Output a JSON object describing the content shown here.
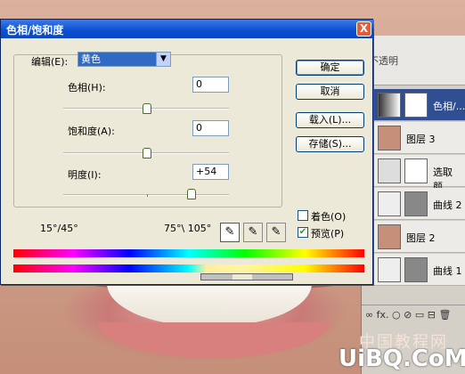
{
  "dialog": {
    "title": "色相/饱和度",
    "close_label": "X",
    "edit_label": "编辑(E):",
    "edit_value": "黄色",
    "hue": {
      "label": "色相(H):",
      "value": "0",
      "slider_pct": 50
    },
    "saturation": {
      "label": "饱和度(A):",
      "value": "0",
      "slider_pct": 50
    },
    "lightness": {
      "label": "明度(I):",
      "value": "+54",
      "slider_pct": 77
    },
    "buttons": {
      "ok": "确定",
      "cancel": "取消",
      "load": "载入(L)...",
      "save": "存储(S)..."
    },
    "range_left": "15°/45°",
    "range_right": "75°\\ 105°",
    "colorize_label": "着色(O)",
    "colorize_checked": false,
    "preview_label": "预览(P)",
    "preview_checked": true
  },
  "layers": {
    "opacity_label": "不透明",
    "items": [
      {
        "name": "色相/...",
        "active": true
      },
      {
        "name": "图层 3",
        "active": false
      },
      {
        "name": "选取颜...",
        "active": false
      },
      {
        "name": "曲线 2",
        "active": false
      },
      {
        "name": "图层 2",
        "active": false
      },
      {
        "name": "曲线 1",
        "active": false
      }
    ],
    "footer": "∞ fx. ○ ⊘ ▭ ⊟ 🗑"
  },
  "watermark": {
    "line1": "中国教程网",
    "line2": "UiBQ.CoM"
  },
  "colors": {
    "titlebar": "#0a4fd3",
    "dialog_bg": "#ece9d8",
    "selected": "#316ac5"
  }
}
